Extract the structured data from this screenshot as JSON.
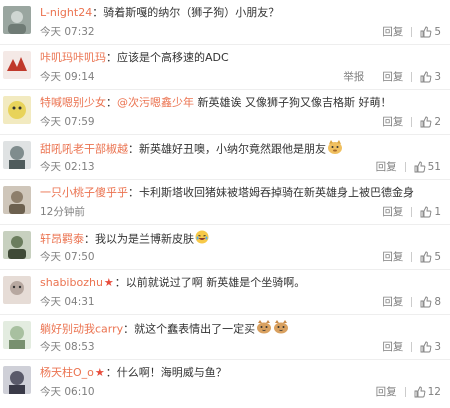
{
  "comments": [
    {
      "user": "L-night24",
      "vip": false,
      "mention": "",
      "text": "骑着斯嘎的纳尔（狮子狗）小朋友？",
      "time": "今天 07:32",
      "report": "",
      "reply": "回复",
      "likes": "5",
      "avatar_color": "#9aa6a0"
    },
    {
      "user": "咔叽玛咔叽玛",
      "vip": false,
      "mention": "",
      "text": "应该是个高移速的ADC",
      "time": "今天 09:14",
      "report": "举报",
      "reply": "回复",
      "likes": "3",
      "avatar_color": "#c0392b"
    },
    {
      "user": "特喊嗯别少女",
      "vip": false,
      "mention": "@次污嗯鑫少年",
      "text": "新英雄诶 又像狮子狗又像吉格斯 好萌！",
      "time": "今天 07:59",
      "report": "",
      "reply": "回复",
      "likes": "2",
      "avatar_color": "#e8d35a"
    },
    {
      "user": "甜吼吼老干部椒越",
      "vip": false,
      "mention": "",
      "text": "新英雄好丑噢，小纳尔竟然跟他是朋友",
      "time": "今天 02:13",
      "report": "",
      "reply": "回复",
      "likes": "51",
      "avatar_color": "#7f8c8d"
    },
    {
      "user": "一只小桃子傻乎乎",
      "vip": false,
      "mention": "",
      "text": "卡利斯塔收回猪妹被塔姆吞掉骑在新英雄身上被巴德金身",
      "time": "12分钟前",
      "report": "",
      "reply": "回复",
      "likes": "1",
      "avatar_color": "#8e7f6c"
    },
    {
      "user": "轩昂羁泰",
      "vip": false,
      "mention": "",
      "text": "我以为是兰博新皮肤",
      "time": "今天 07:50",
      "report": "",
      "reply": "回复",
      "likes": "5",
      "avatar_color": "#6b7d5e"
    },
    {
      "user": "shabibozhu",
      "vip": true,
      "mention": "",
      "text": "以前就说过了啊 新英雄是个坐骑啊。",
      "time": "今天 04:31",
      "report": "",
      "reply": "回复",
      "likes": "8",
      "avatar_color": "#b7a8a0"
    },
    {
      "user": "躺好别动我carry",
      "vip": false,
      "mention": "",
      "text": "就这个蠢表情出了一定买",
      "time": "今天 08:53",
      "report": "",
      "reply": "回复",
      "likes": "3",
      "avatar_color": "#a8c0a0"
    },
    {
      "user": "杨天柱O_o",
      "vip": true,
      "mention": "",
      "text": "什么啊！海明威与鱼？",
      "time": "今天 06:10",
      "report": "",
      "reply": "回复",
      "likes": "12",
      "avatar_color": "#5a5a6a"
    }
  ],
  "colors": {
    "username": "#eb7350",
    "meta": "#808080",
    "text": "#333333"
  },
  "icons": {
    "like": "thumbs-up-icon",
    "vip": "star-badge-icon"
  }
}
